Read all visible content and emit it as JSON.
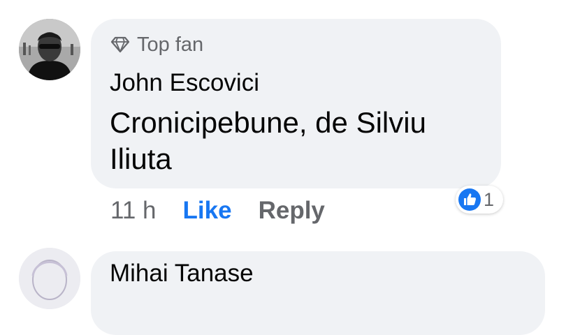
{
  "comments": [
    {
      "badge": "Top fan",
      "badge_icon": "diamond-icon",
      "author": "John Escovici",
      "text": "Cronicipebune, de Silviu Iliuta",
      "time": "11 h",
      "like_label": "Like",
      "reply_label": "Reply",
      "reaction_icon": "thumbs-up-icon",
      "reaction_count": "1"
    },
    {
      "author": "Mihai Tanase"
    }
  ],
  "colors": {
    "bubble": "#f0f2f5",
    "like": "#1877f2",
    "secondary_text": "#65676b"
  }
}
